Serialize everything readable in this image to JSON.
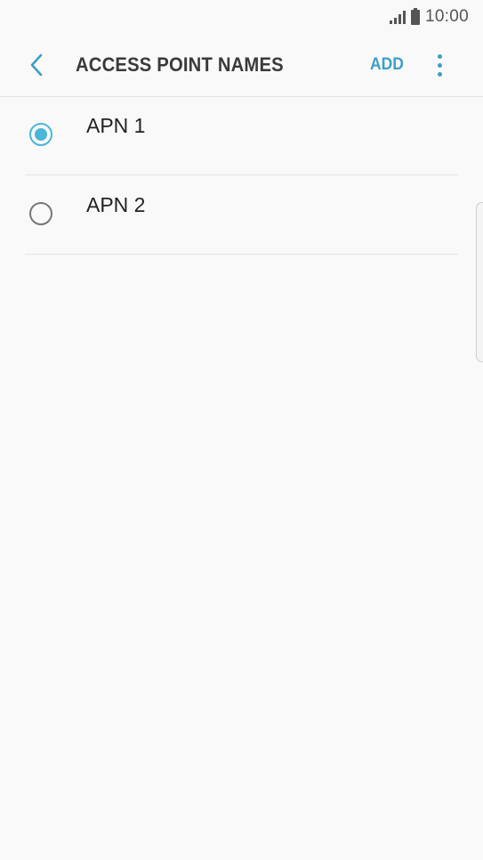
{
  "status_bar": {
    "time": "10:00",
    "icons": [
      "signal-icon",
      "battery-icon"
    ]
  },
  "app_bar": {
    "title": "ACCESS POINT NAMES",
    "add_label": "ADD",
    "back_icon": "chevron-left-icon",
    "more_icon": "more-vert-icon"
  },
  "apns": [
    {
      "label": "APN 1",
      "selected": true
    },
    {
      "label": "APN 2",
      "selected": false
    }
  ],
  "colors": {
    "accent": "#4ab6d9",
    "link": "#3d9fc4",
    "title": "#3a3a3a",
    "background": "#f9f9f9"
  }
}
